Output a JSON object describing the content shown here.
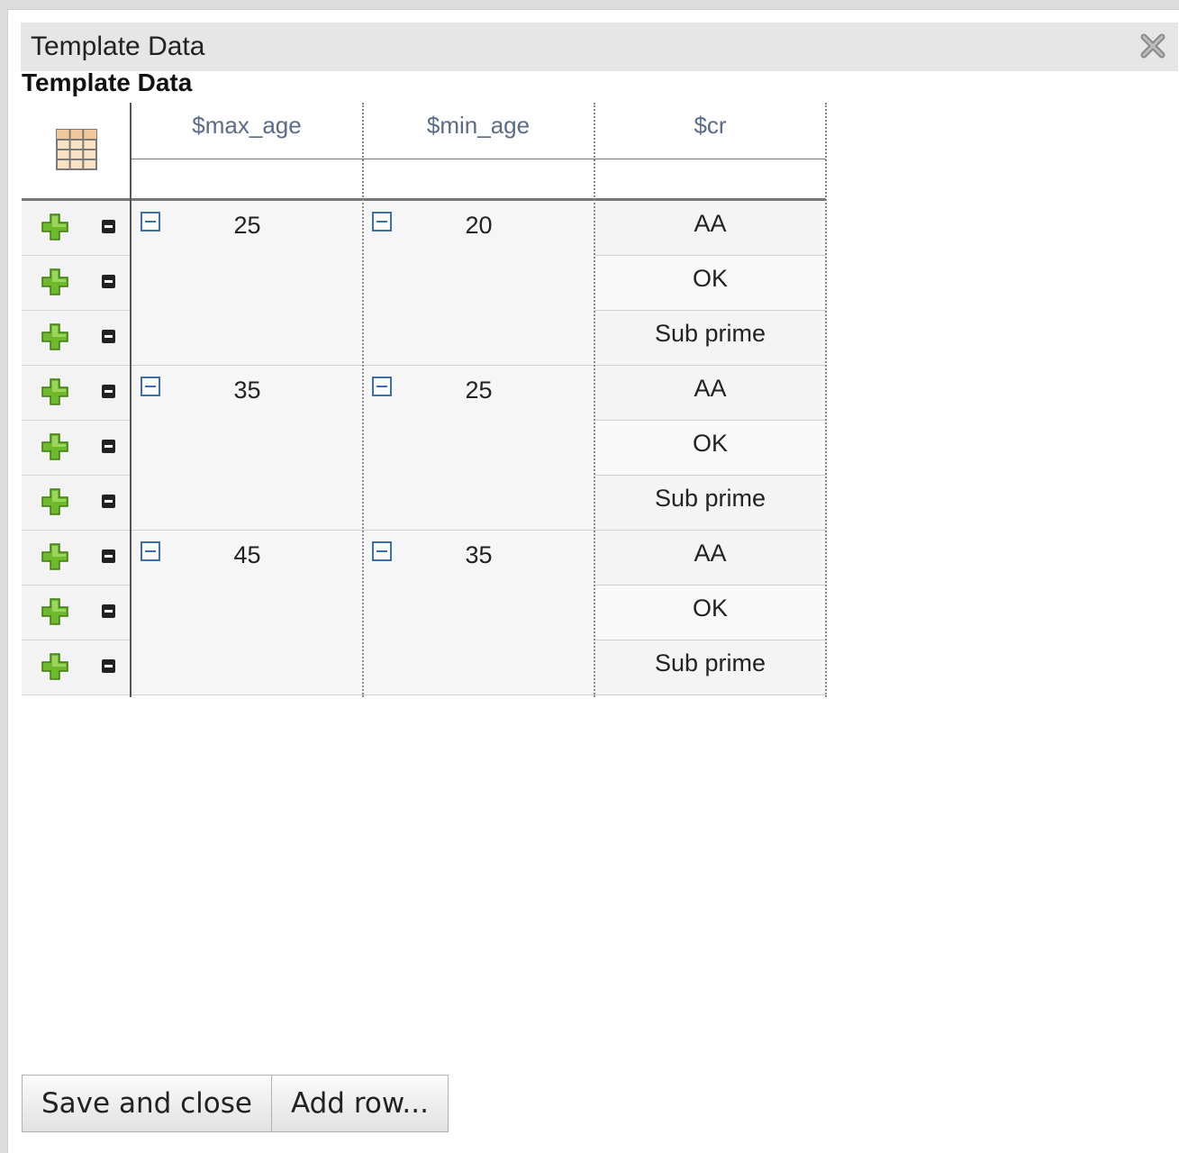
{
  "window": {
    "title": "Template Data"
  },
  "section": {
    "title": "Template Data"
  },
  "columns": [
    "$max_age",
    "$min_age",
    "$cr"
  ],
  "groups": [
    {
      "max_age": "25",
      "min_age": "20",
      "cr": [
        "AA",
        "OK",
        "Sub prime"
      ]
    },
    {
      "max_age": "35",
      "min_age": "25",
      "cr": [
        "AA",
        "OK",
        "Sub prime"
      ]
    },
    {
      "max_age": "45",
      "min_age": "35",
      "cr": [
        "AA",
        "OK",
        "Sub prime"
      ]
    }
  ],
  "buttons": {
    "save_close": "Save and close",
    "add_row": "Add row..."
  },
  "icons": {
    "close": "close-icon",
    "table": "table-icon",
    "add_row": "add-row-icon",
    "delete_row": "delete-row-icon",
    "collapse": "collapse-icon"
  },
  "colors": {
    "header_text": "#5a6b8a",
    "add_green": "#6fba2c",
    "collapse_blue": "#3d6fae"
  }
}
